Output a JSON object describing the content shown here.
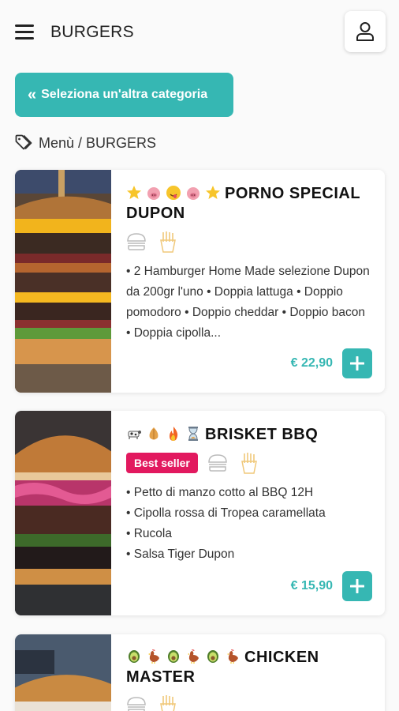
{
  "header": {
    "title": "BURGERS"
  },
  "category_button": {
    "chevron": "«",
    "label": "Seleziona un'altra categoria"
  },
  "breadcrumb": {
    "text": "Menù / BURGERS"
  },
  "colors": {
    "accent": "#36b7b3",
    "badge": "#e2195f"
  },
  "products": [
    {
      "title": "PORNO SPECIAL DUPON",
      "emojis": [
        "star",
        "pig",
        "drooling-face",
        "pig",
        "star"
      ],
      "description": "• 2 Hamburger Home Made selezione Dupon da 200gr l'uno • Doppia lattuga • Doppio pomodoro • Doppio cheddar • Doppio bacon • Doppia cipolla...",
      "price": "€ 22,90"
    },
    {
      "title": "BRISKET BBQ",
      "emojis": [
        "cow",
        "onion",
        "fire",
        "hourglass"
      ],
      "badge": "Best seller",
      "description_lines": [
        "• Petto di manzo cotto al BBQ 12H",
        "• Cipolla rossa di Tropea caramellata",
        "• Rucola",
        "• Salsa Tiger Dupon"
      ],
      "price": "€ 15,90"
    },
    {
      "title": "CHICKEN MASTER",
      "emojis": [
        "avocado",
        "rooster",
        "avocado",
        "rooster",
        "avocado",
        "rooster"
      ]
    }
  ]
}
